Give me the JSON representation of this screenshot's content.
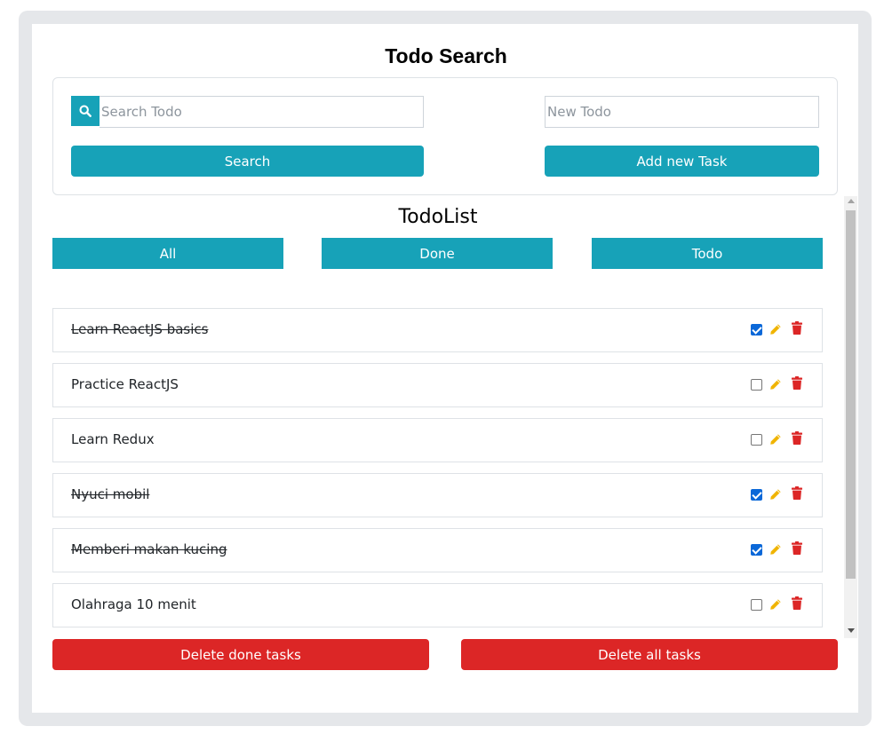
{
  "search_section": {
    "title": "Todo Search",
    "search_placeholder": "Search Todo",
    "search_value": "",
    "search_button_label": "Search",
    "new_todo_placeholder": "New Todo",
    "new_todo_value": "",
    "add_button_label": "Add new Task"
  },
  "list_section": {
    "title": "TodoList",
    "filters": [
      "All",
      "Done",
      "Todo"
    ],
    "items": [
      {
        "text": "Learn ReactJS basics",
        "done": true
      },
      {
        "text": "Practice ReactJS",
        "done": false
      },
      {
        "text": "Learn Redux",
        "done": false
      },
      {
        "text": "Nyuci mobil",
        "done": true
      },
      {
        "text": "Memberi makan kucing",
        "done": true
      },
      {
        "text": "Olahraga 10 menit",
        "done": false
      }
    ],
    "delete_done_label": "Delete done tasks",
    "delete_all_label": "Delete all tasks"
  },
  "colors": {
    "primary": "#17a2b8",
    "danger": "#dc2626",
    "edit": "#f0b400",
    "checkbox": "#0b68d8",
    "frame": "#e5e7ea"
  },
  "icons": {
    "search": "search-icon",
    "edit": "pencil-icon",
    "delete": "trash-icon"
  }
}
